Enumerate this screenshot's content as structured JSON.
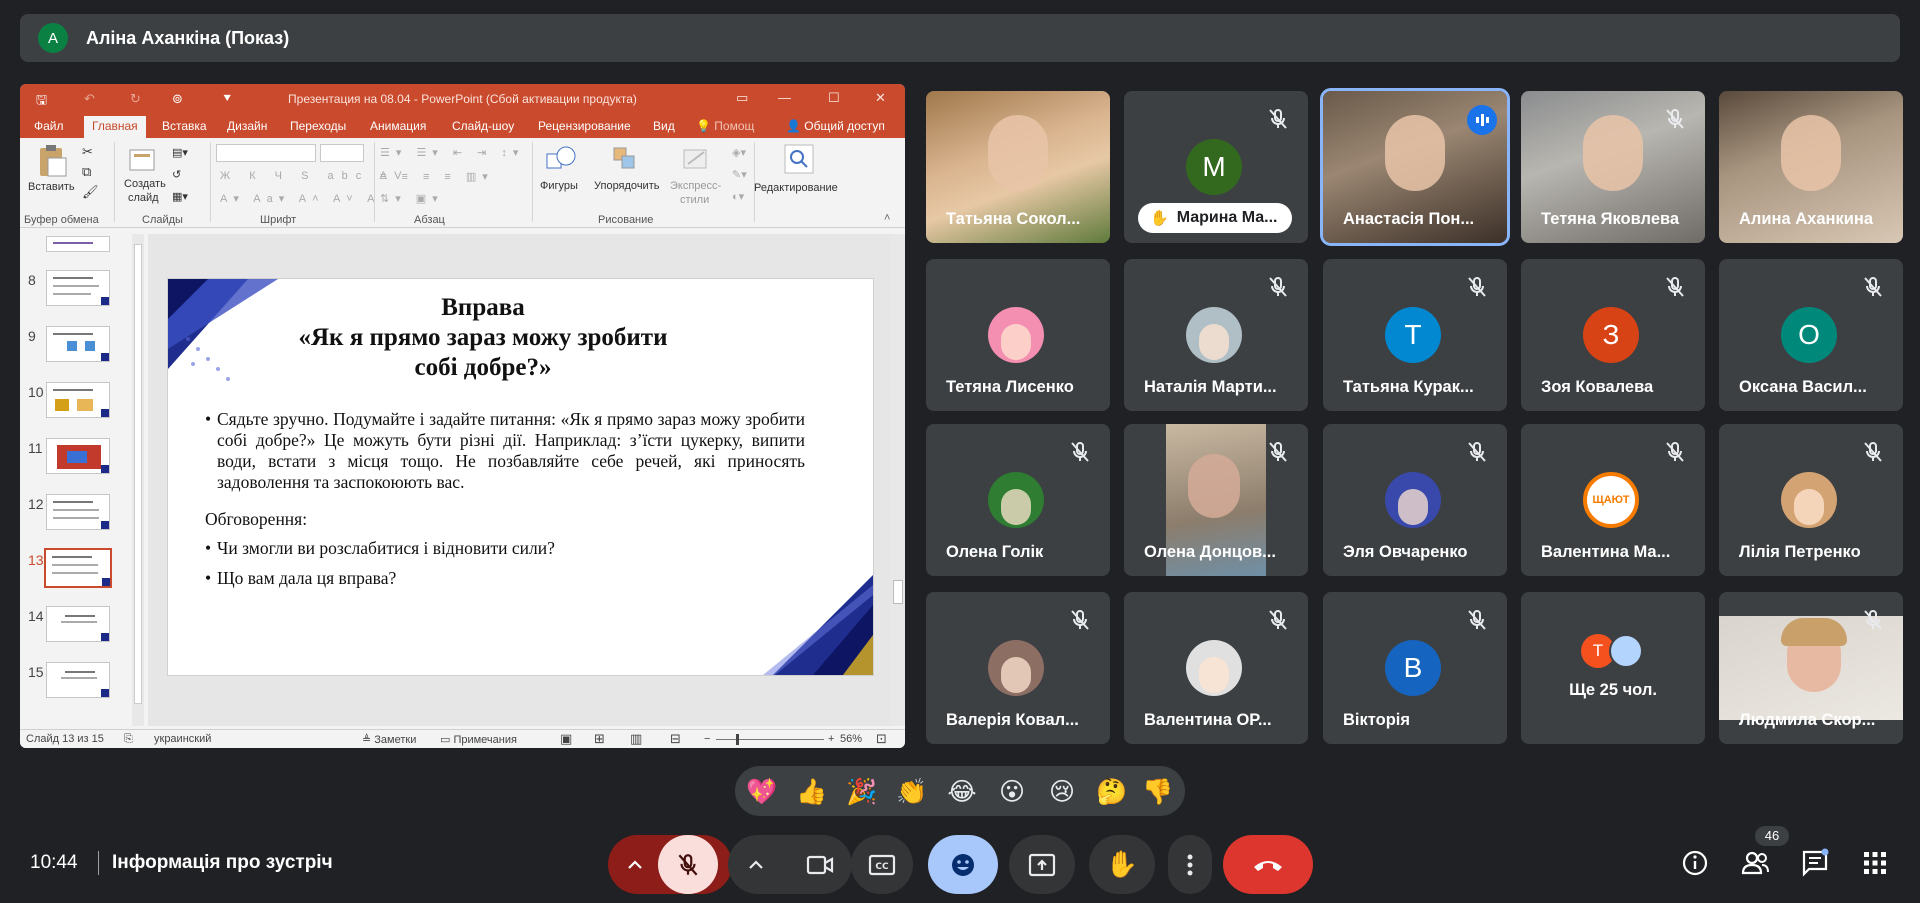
{
  "presenter": {
    "initial": "А",
    "name": "Аліна Аханкіна (Показ)"
  },
  "ppt": {
    "window_title": "Презентация на 08.04 - PowerPoint (Сбой активации продукта)",
    "menu": [
      "Файл",
      "Главная",
      "Вставка",
      "Дизайн",
      "Переходы",
      "Анимация",
      "Слайд-шоу",
      "Рецензирование",
      "Вид",
      "Помощ",
      "Общий доступ"
    ],
    "ribbon": {
      "paste": "Вставить",
      "new_slide_1": "Создать",
      "new_slide_2": "слайд",
      "shapes": "Фигуры",
      "arrange": "Упорядочить",
      "express_1": "Экспресс-",
      "express_2": "стили",
      "editing": "Редактирование",
      "groups": [
        "Буфер обмена",
        "Слайды",
        "Шрифт",
        "Абзац",
        "Рисование"
      ]
    },
    "thumb_numbers": [
      "8",
      "9",
      "10",
      "11",
      "12",
      "13",
      "14",
      "15"
    ],
    "slide": {
      "title_1": "Вправа",
      "title_2": "«Як я прямо зараз можу зробити",
      "title_3": "собі добре?»",
      "bullet_1": "Сядьте зручно. Подумайте і задайте питання: «Як я прямо зараз можу зробити собі добре?» Це можуть бути різні дії. Наприклад: з’їсти цукерку, випити води, встати з місця тощо. Не позбавляйте себе речей, які приносять задоволення та заспокоюють вас.",
      "discussion": "Обговорення:",
      "bullet_2": "Чи змогли ви розслабитися і відновити сили?",
      "bullet_3": "Що вам дала ця вправа?",
      "bullet_char": "•"
    },
    "status": {
      "slide": "Слайд 13 из 15",
      "lang": "украинский",
      "notes": "Заметки",
      "comments": "Примечания",
      "zoom": "56%"
    }
  },
  "participants": [
    {
      "name": "Татьяна Сокол...",
      "muted": false,
      "kind": "photo"
    },
    {
      "name": "Марина Ма...",
      "initial": "M",
      "color": "#33691e",
      "muted": true,
      "kind": "hand"
    },
    {
      "name": "Анастасія Пон...",
      "muted": false,
      "kind": "photo",
      "speaking": true
    },
    {
      "name": "Тетяна Яковлева",
      "muted": true,
      "kind": "photo"
    },
    {
      "name": "Алина Аханкина",
      "muted": false,
      "kind": "photo"
    },
    {
      "name": "Тетяна Лисенко",
      "muted": false,
      "kind": "avatar-img",
      "color": "#f48fb1"
    },
    {
      "name": "Наталія Марти...",
      "muted": true,
      "kind": "avatar-img",
      "color": "#b0bec5"
    },
    {
      "name": "Татьяна Курак...",
      "initial": "T",
      "color": "#0288d1",
      "muted": true,
      "kind": "initial"
    },
    {
      "name": "Зоя Ковалева",
      "initial": "З",
      "color": "#d84315",
      "muted": true,
      "kind": "initial"
    },
    {
      "name": "Оксана Васил...",
      "initial": "O",
      "color": "#00897b",
      "muted": true,
      "kind": "initial"
    },
    {
      "name": "Олена Голік",
      "muted": true,
      "kind": "avatar-img",
      "color": "#2e7d32"
    },
    {
      "name": "Олена Донцов...",
      "muted": true,
      "kind": "photo-narrow"
    },
    {
      "name": "Эля Овчаренко",
      "muted": true,
      "kind": "avatar-img",
      "color": "#3949ab"
    },
    {
      "name": "Валентина Ма...",
      "muted": true,
      "kind": "logo",
      "logo_text": "ЩАЮТ"
    },
    {
      "name": "Лілія Петренко",
      "muted": true,
      "kind": "avatar-img",
      "color": "#d4a373"
    },
    {
      "name": "Валерія Ковал...",
      "muted": true,
      "kind": "avatar-img",
      "color": "#8d6e63"
    },
    {
      "name": "Валентина ОР...",
      "muted": true,
      "kind": "avatar-img",
      "color": "#e0e0e0"
    },
    {
      "name": "Вікторія",
      "initial": "B",
      "color": "#1565c0",
      "muted": true,
      "kind": "initial"
    },
    {
      "name": "Ще 25 чол.",
      "initial": "T",
      "color": "#f4511e",
      "muted": false,
      "kind": "more"
    },
    {
      "name": "Людмила Скор...",
      "muted": true,
      "kind": "photo-inset"
    }
  ],
  "reactions": [
    "💖",
    "👍",
    "🎉",
    "👏",
    "😂",
    "😮",
    "😢",
    "🤔",
    "👎"
  ],
  "bottom": {
    "time": "10:44",
    "info": "Інформація про зустріч",
    "people_count": "46"
  }
}
